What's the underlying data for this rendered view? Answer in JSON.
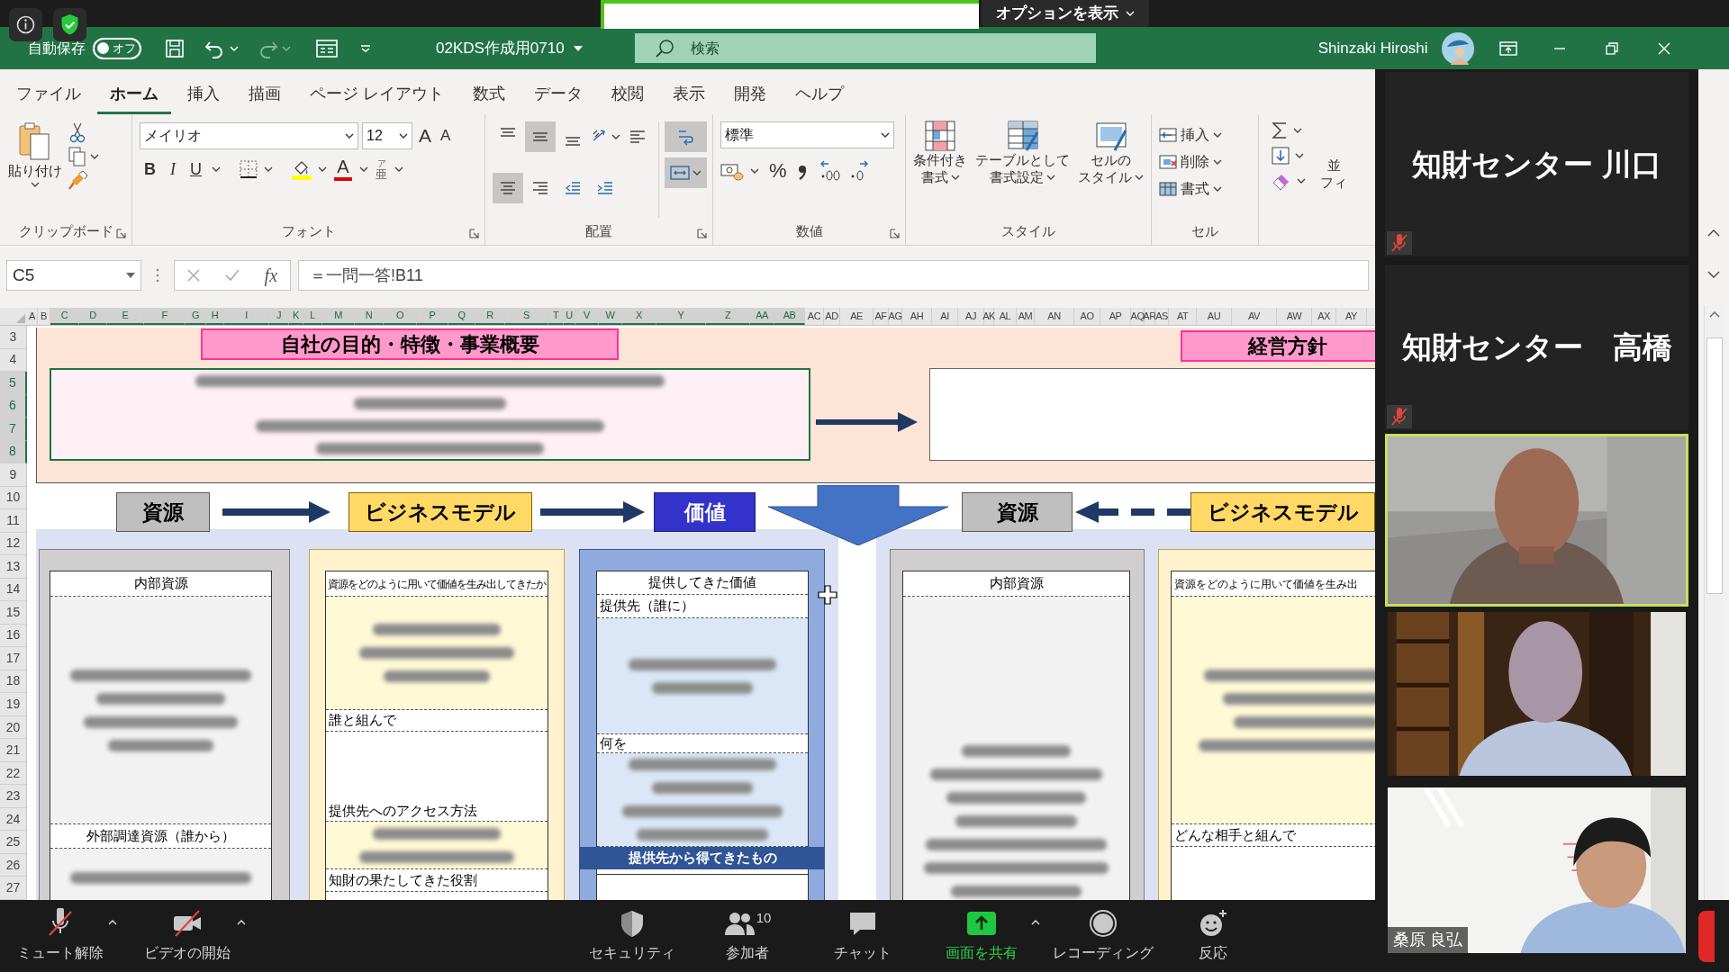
{
  "top_strip": {
    "options_button": "オプションを表示"
  },
  "title_bar": {
    "autosave_label": "自動保存",
    "autosave_toggle": {
      "label": "オフ",
      "on": false
    },
    "document_title": "02KDS作成用0710",
    "search_placeholder": "検索",
    "user_name": "Shinzaki Hiroshi"
  },
  "ribbon_tabs": [
    {
      "label": "ファイル",
      "selected": false
    },
    {
      "label": "ホーム",
      "selected": true
    },
    {
      "label": "挿入",
      "selected": false
    },
    {
      "label": "描画",
      "selected": false
    },
    {
      "label": "ページ レイアウト",
      "selected": false
    },
    {
      "label": "数式",
      "selected": false
    },
    {
      "label": "データ",
      "selected": false
    },
    {
      "label": "校閲",
      "selected": false
    },
    {
      "label": "表示",
      "selected": false
    },
    {
      "label": "開発",
      "selected": false
    },
    {
      "label": "ヘルプ",
      "selected": false
    }
  ],
  "ribbon": {
    "clipboard": {
      "paste_label": "貼り付け",
      "group_label": "クリップボード"
    },
    "font": {
      "font_name": "メイリオ",
      "font_size": "12",
      "grow_font": "A",
      "shrink_font": "A",
      "bold": "B",
      "italic": "I",
      "underline": "U",
      "font_color": "A",
      "phonetic_ruby": "ア",
      "phonetic_base": "亜",
      "group_label": "フォント"
    },
    "alignment": {
      "buttons": [
        {
          "kind": "top",
          "pressed": false
        },
        {
          "kind": "middle",
          "pressed": true
        },
        {
          "kind": "bottom",
          "pressed": false
        },
        {
          "kind": "orientation",
          "pressed": false
        },
        {
          "kind": "left",
          "pressed": false
        },
        {
          "kind": "center",
          "pressed": true
        },
        {
          "kind": "right",
          "pressed": false
        },
        {
          "kind": "outdent",
          "pressed": false
        },
        {
          "kind": "indent",
          "pressed": false
        },
        {
          "kind": "wrap",
          "pressed": true
        },
        {
          "kind": "merge",
          "pressed": true
        }
      ],
      "group_label": "配置"
    },
    "number": {
      "format": "標準",
      "percent": "%",
      "group_label": "数値"
    },
    "styles": {
      "buttons": [
        {
          "lines": [
            "条件付き",
            "書式"
          ]
        },
        {
          "lines": [
            "テーブルとして",
            "書式設定"
          ]
        },
        {
          "lines": [
            "セルの",
            "スタイル"
          ]
        }
      ],
      "group_label": "スタイル"
    },
    "cells": {
      "buttons": [
        {
          "kind": "insert",
          "label": "挿入"
        },
        {
          "kind": "delete",
          "label": "削除"
        },
        {
          "kind": "format",
          "label": "書式"
        }
      ],
      "group_label": "セル"
    },
    "editing": {
      "sort_filter_lines": [
        "並",
        "フィ"
      ]
    }
  },
  "formula_bar": {
    "name_box": "C5",
    "function_label": "fx",
    "formula": "＝一問一答!B11"
  },
  "columns": [
    {
      "label": "A",
      "selected": false
    },
    {
      "label": "B",
      "selected": false
    },
    {
      "label": "C",
      "selected": true
    },
    {
      "label": "D",
      "selected": true
    },
    {
      "label": "E",
      "selected": true
    },
    {
      "label": "F",
      "selected": true
    },
    {
      "label": "G",
      "selected": true
    },
    {
      "label": "H",
      "selected": true
    },
    {
      "label": "I",
      "selected": true
    },
    {
      "label": "J",
      "selected": true
    },
    {
      "label": "K",
      "selected": true
    },
    {
      "label": "L",
      "selected": true
    },
    {
      "label": "M",
      "selected": true
    },
    {
      "label": "N",
      "selected": true
    },
    {
      "label": "O",
      "selected": true
    },
    {
      "label": "P",
      "selected": true
    },
    {
      "label": "Q",
      "selected": true
    },
    {
      "label": "R",
      "selected": true
    },
    {
      "label": "S",
      "selected": true
    },
    {
      "label": "T",
      "selected": true
    },
    {
      "label": "U",
      "selected": true
    },
    {
      "label": "V",
      "selected": true
    },
    {
      "label": "W",
      "selected": true
    },
    {
      "label": "X",
      "selected": true
    },
    {
      "label": "Y",
      "selected": true
    },
    {
      "label": "Z",
      "selected": true
    },
    {
      "label": "AA",
      "selected": true
    },
    {
      "label": "AB",
      "selected": true
    },
    {
      "label": "AC",
      "selected": false
    },
    {
      "label": "AD",
      "selected": false
    },
    {
      "label": "AE",
      "selected": false
    },
    {
      "label": "AF",
      "selected": false
    },
    {
      "label": "AG",
      "selected": false
    },
    {
      "label": "AH",
      "selected": false
    },
    {
      "label": "AI",
      "selected": false
    },
    {
      "label": "AJ",
      "selected": false
    },
    {
      "label": "AK",
      "selected": false
    },
    {
      "label": "AL",
      "selected": false
    },
    {
      "label": "AM",
      "selected": false
    },
    {
      "label": "AN",
      "selected": false
    },
    {
      "label": "AO",
      "selected": false
    },
    {
      "label": "AP",
      "selected": false
    },
    {
      "label": "AQ",
      "selected": false
    },
    {
      "label": "AR",
      "selected": false
    },
    {
      "label": "AS",
      "selected": false
    },
    {
      "label": "AT",
      "selected": false
    },
    {
      "label": "AU",
      "selected": false
    },
    {
      "label": "AV",
      "selected": false
    },
    {
      "label": "AW",
      "selected": false
    },
    {
      "label": "AX",
      "selected": false
    },
    {
      "label": "AY",
      "selected": false
    }
  ],
  "rows": [
    {
      "label": "3",
      "selected": false
    },
    {
      "label": "4",
      "selected": false
    },
    {
      "label": "5",
      "selected": true
    },
    {
      "label": "6",
      "selected": true
    },
    {
      "label": "7",
      "selected": true
    },
    {
      "label": "8",
      "selected": true
    },
    {
      "label": "9",
      "selected": false
    },
    {
      "label": "10",
      "selected": false
    },
    {
      "label": "11",
      "selected": false
    },
    {
      "label": "12",
      "selected": false
    },
    {
      "label": "13",
      "selected": false
    },
    {
      "label": "14",
      "selected": false
    },
    {
      "label": "15",
      "selected": false
    },
    {
      "label": "16",
      "selected": false
    },
    {
      "label": "17",
      "selected": false
    },
    {
      "label": "18",
      "selected": false
    },
    {
      "label": "19",
      "selected": false
    },
    {
      "label": "20",
      "selected": false
    },
    {
      "label": "21",
      "selected": false
    },
    {
      "label": "22",
      "selected": false
    },
    {
      "label": "23",
      "selected": false
    },
    {
      "label": "24",
      "selected": false
    },
    {
      "label": "25",
      "selected": false
    },
    {
      "label": "26",
      "selected": false
    },
    {
      "label": "27",
      "selected": false
    }
  ],
  "sheet": {
    "purpose_title": "自社の目的・特徴・事業概要",
    "policy_title": "経営方針",
    "flow_left": [
      {
        "kind": "resource",
        "label": "資源"
      },
      {
        "kind": "model",
        "label": "ビジネスモデル"
      },
      {
        "kind": "value",
        "label": "価値"
      }
    ],
    "flow_right": [
      {
        "kind": "resource",
        "label": "資源"
      },
      {
        "kind": "model",
        "label": "ビジネスモデル"
      }
    ],
    "cards": [
      {
        "kind": "resource",
        "sections": [
          {
            "kind": "label",
            "text": "内部資源"
          },
          {
            "kind": "blurred"
          },
          {
            "kind": "label",
            "text": "外部調達資源（誰から）"
          },
          {
            "kind": "blurred"
          }
        ]
      },
      {
        "kind": "model",
        "sections": [
          {
            "kind": "label",
            "text": "資源をどのように用いて価値を生み出してきたか"
          },
          {
            "kind": "blurred"
          },
          {
            "kind": "label",
            "text": "誰と組んで"
          },
          {
            "kind": "blank"
          },
          {
            "kind": "label",
            "text": "提供先へのアクセス方法"
          },
          {
            "kind": "blurred"
          },
          {
            "kind": "label",
            "text": "知財の果たしてきた役割"
          },
          {
            "kind": "blank"
          }
        ]
      },
      {
        "kind": "value",
        "sections": [
          {
            "kind": "label",
            "text": "提供してきた価値"
          },
          {
            "kind": "label",
            "text": "提供先（誰に）"
          },
          {
            "kind": "blurred"
          },
          {
            "kind": "label",
            "text": "何を"
          },
          {
            "kind": "blurred"
          },
          {
            "kind": "band",
            "text": "提供先から得てきたもの"
          },
          {
            "kind": "blank"
          }
        ]
      },
      {
        "kind": "resource",
        "sections": [
          {
            "kind": "label",
            "text": "内部資源"
          },
          {
            "kind": "blurred"
          }
        ]
      },
      {
        "kind": "model",
        "sections": [
          {
            "kind": "label",
            "text": "資源をどのように用いて価値を生み出"
          },
          {
            "kind": "blurred"
          },
          {
            "kind": "label",
            "text": "どんな相手と組んで"
          },
          {
            "kind": "blank"
          }
        ]
      }
    ]
  },
  "zoom_panel": {
    "name_tiles": [
      {
        "name": "知財センター 川口",
        "muted": true
      },
      {
        "name": "知財センター　高橋",
        "muted": true
      }
    ],
    "video_tiles": [
      {
        "kind": "picture",
        "speaking": true
      },
      {
        "kind": "picture",
        "speaking": false
      },
      {
        "kind": "picture",
        "speaking": false,
        "name": "桑原 良弘"
      }
    ]
  },
  "meeting_toolbar": [
    {
      "kind": "mic",
      "label": "ミュート解除",
      "off": true
    },
    {
      "kind": "video",
      "label": "ビデオの開始",
      "off": true
    },
    {
      "kind": "security",
      "label": "セキュリティ"
    },
    {
      "kind": "participants",
      "label": "参加者",
      "count": "10"
    },
    {
      "kind": "chat",
      "label": "チャット"
    },
    {
      "kind": "share",
      "label": "画面を共有"
    },
    {
      "kind": "record",
      "label": "レコーディング"
    },
    {
      "kind": "reactions",
      "label": "反応"
    }
  ]
}
